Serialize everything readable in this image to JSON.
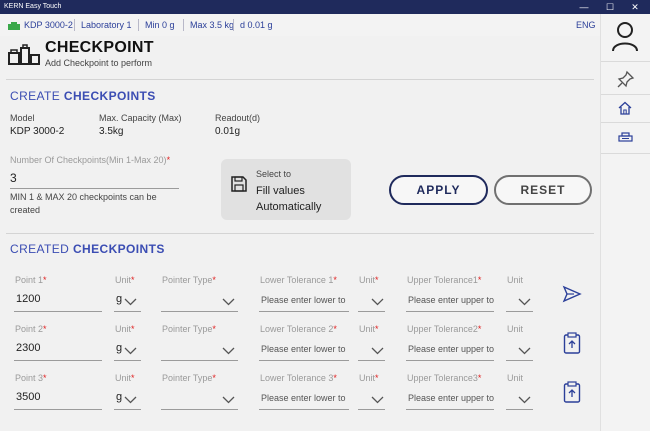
{
  "window": {
    "title": "KERN Easy Touch",
    "minimize": "—",
    "maximize": "☐",
    "close": "✕"
  },
  "infobar": {
    "device": "KDP 3000-2",
    "lab": "Laboratory 1",
    "min": "Min 0 g",
    "max": "Max 3.5 kg",
    "d": "d 0.01 g",
    "lang": "ENG"
  },
  "header": {
    "title": "CHECKPOINT",
    "subtitle": "Add Checkpoint to perform"
  },
  "create": {
    "title_pre": "CREATE ",
    "title_bold": "CHECKPOINTS",
    "model_label": "Model",
    "model_value": "KDP 3000-2",
    "cap_label": "Max. Capacity (Max)",
    "cap_value": "3.5kg",
    "readout_label": "Readout(d)",
    "readout_value": "0.01g",
    "num_label": "Number Of Checkpoints(Min 1-Max 20)",
    "num_value": "3",
    "hint": "MIN 1 & MAX 20 checkpoints can be created",
    "fill_select": "Select to",
    "fill_line1": "Fill values",
    "fill_line2": "Automatically",
    "apply": "APPLY",
    "reset": "RESET"
  },
  "created": {
    "title_pre": "CREATED ",
    "title_bold": "CHECKPOINTS",
    "rows": [
      {
        "point_label": "Point 1",
        "point_value": "1200",
        "unit_label": "Unit",
        "unit_value": "g",
        "pointer_label": "Pointer Type",
        "lower_label": "Lower Tolerance 1",
        "lower_ph": "Please enter lower to",
        "unit2_label": "Unit",
        "upper_label": "Upper Tolerance1",
        "upper_ph": "Please enter upper to",
        "unit3_label": "Unit"
      },
      {
        "point_label": "Point 2",
        "point_value": "2300",
        "unit_label": "Unit",
        "unit_value": "g",
        "pointer_label": "Pointer Type",
        "lower_label": "Lower Tolerance 2",
        "lower_ph": "Please enter lower to",
        "unit2_label": "Unit",
        "upper_label": "Upper Tolerance2",
        "upper_ph": "Please enter upper to",
        "unit3_label": "Unit"
      },
      {
        "point_label": "Point 3",
        "point_value": "3500",
        "unit_label": "Unit",
        "unit_value": "g",
        "pointer_label": "Pointer Type",
        "lower_label": "Lower Tolerance 3",
        "lower_ph": "Please enter lower to",
        "unit2_label": "Unit",
        "upper_label": "Upper Tolerance3",
        "upper_ph": "Please enter upper to",
        "unit3_label": "Unit"
      }
    ]
  },
  "colors": {
    "accent": "#3b4db3",
    "dark_navy": "#1f2a5c",
    "required": "#e02020"
  },
  "icons": [
    "user-avatar-icon",
    "pin-icon",
    "home-icon",
    "weight-scale-icon",
    "send-icon",
    "paste-icon"
  ]
}
